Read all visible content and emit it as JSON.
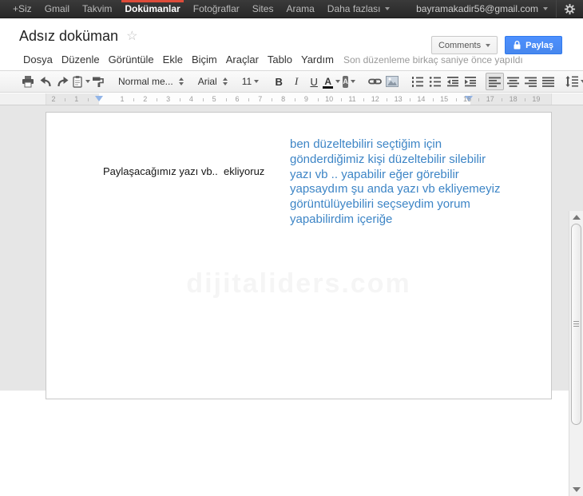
{
  "topbar": {
    "items": [
      "+Siz",
      "Gmail",
      "Takvim",
      "Dokümanlar",
      "Fotoğraflar",
      "Sites",
      "Arama",
      "Daha fazlası"
    ],
    "active_item": "Dokümanlar",
    "dropdown_item": "Daha fazlası",
    "account_email": "bayramakadir56@gmail.com"
  },
  "header": {
    "title": "Adsız doküman",
    "comments_button": "Comments",
    "share_button": "Paylaş",
    "menus": [
      "Dosya",
      "Düzenle",
      "Görüntüle",
      "Ekle",
      "Biçim",
      "Araçlar",
      "Tablo",
      "Yardım"
    ],
    "last_edit_status": "Son düzenleme birkaç saniye önce yapıldı"
  },
  "toolbar": {
    "style_selector": "Normal me...",
    "font_selector": "Arial",
    "font_size": "11",
    "bold_label": "B",
    "italic_label": "I",
    "underline_label": "U",
    "text_color_label": "A",
    "highlight_label": "A"
  },
  "ruler": {
    "left_numbers": [
      "2",
      "1"
    ],
    "numbers": [
      "1",
      "2",
      "3",
      "4",
      "5",
      "6",
      "7",
      "8",
      "9",
      "10",
      "11",
      "12",
      "13",
      "14",
      "15",
      "16",
      "17",
      "18",
      "19"
    ]
  },
  "document": {
    "paragraph_text": "Paylaşacağımız yazı vb..  ekliyoruz",
    "blue_text_lines": [
      "ben düzeltebiliri seçtiğim için",
      "gönderdiğimiz kişi düzeltebilir silebilir",
      "yazı vb ..  yapabilir eğer görebilir",
      "yapsaydım şu anda yazı vb ekliyemeyiz",
      "görüntülüyebiliri seçseydim yorum",
      "yapabilirdim içeriğe"
    ],
    "watermark": "dijitaliders.com"
  },
  "icons": {
    "star": "☆"
  },
  "colors": {
    "blue_text": "#3d85c6",
    "share_button": "#4d90fe",
    "active_tab_underline": "#dd4b39"
  }
}
